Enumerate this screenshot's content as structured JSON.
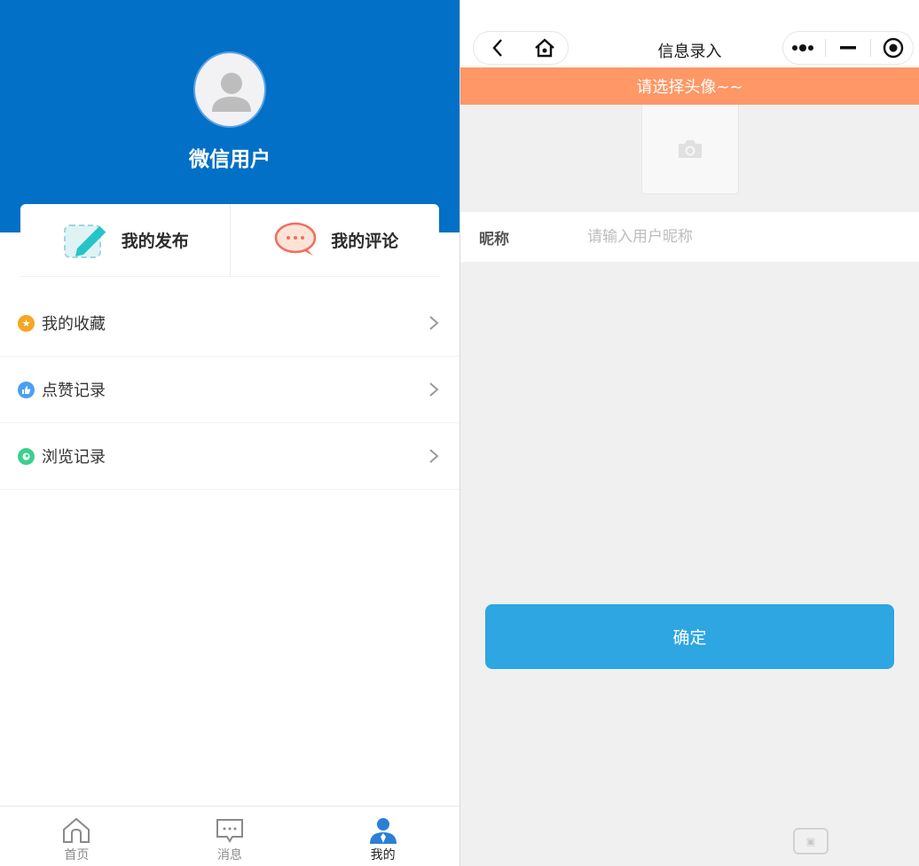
{
  "left": {
    "user_name": "微信用户",
    "actions": [
      {
        "label": "我的发布",
        "icon": "edit-pencil-icon"
      },
      {
        "label": "我的评论",
        "icon": "comment-bubble-icon"
      }
    ],
    "menu": [
      {
        "label": "我的收藏",
        "icon": "star-icon",
        "color": "#f5a623"
      },
      {
        "label": "点赞记录",
        "icon": "thumb-up-icon",
        "color": "#4a9ff5"
      },
      {
        "label": "浏览记录",
        "icon": "eye-icon",
        "color": "#3ccf8e"
      }
    ],
    "tabs": [
      {
        "label": "首页",
        "icon": "home-icon",
        "active": false
      },
      {
        "label": "消息",
        "icon": "message-icon",
        "active": false
      },
      {
        "label": "我的",
        "icon": "user-icon",
        "active": true
      }
    ],
    "colors": {
      "header": "#0270c6",
      "tab_active": "#2b7fd6"
    }
  },
  "right": {
    "nav_title": "信息录入",
    "alert": "请选择头像~~",
    "nickname_label": "昵称",
    "nickname_placeholder": "请输入用户昵称",
    "nickname_value": "",
    "confirm_label": "确定",
    "colors": {
      "alert": "#ff9766",
      "confirm": "#2da6e1"
    }
  }
}
